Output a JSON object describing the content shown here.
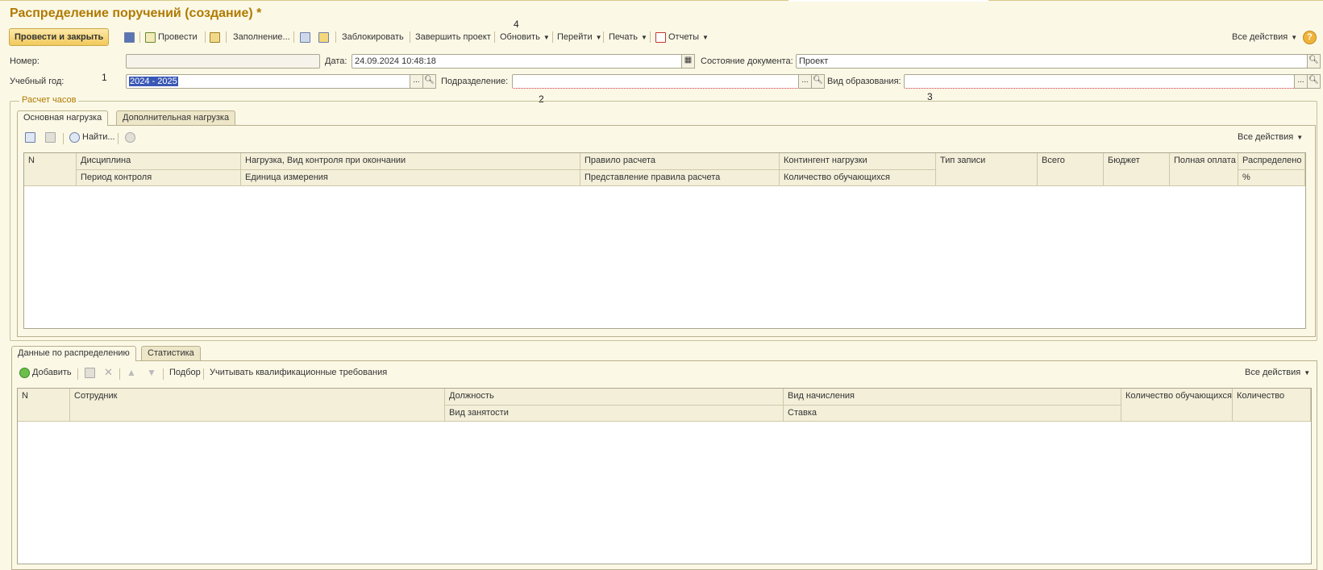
{
  "window": {
    "title": "Распределение поручений (создание) *"
  },
  "toolbar": {
    "post_close": "Провести и закрыть",
    "post": "Провести",
    "fill": "Заполнение...",
    "lock": "Заблокировать",
    "finish": "Завершить проект",
    "refresh": "Обновить",
    "goto": "Перейти",
    "print": "Печать",
    "reports": "Отчеты",
    "all_actions": "Все действия",
    "help": "?"
  },
  "annotations": {
    "n1": "1",
    "n2": "2",
    "n3": "3",
    "n4": "4"
  },
  "fields": {
    "number_label": "Номер:",
    "number_value": "",
    "date_label": "Дата:",
    "date_value": "24.09.2024 10:48:18",
    "state_label": "Состояние документа:",
    "state_value": "Проект",
    "year_label": "Учебный год:",
    "year_value": "2024 - 2025",
    "division_label": "Подразделение:",
    "division_value": "",
    "edu_label": "Вид образования:",
    "edu_value": ""
  },
  "hours_group": {
    "title": "Расчет часов",
    "tabs": [
      "Основная нагрузка",
      "Дополнительная нагрузка"
    ],
    "find": "Найти...",
    "all_actions": "Все действия",
    "columns": {
      "n": "N",
      "discipline": "Дисциплина",
      "period": "Период контроля",
      "load": "Нагрузка, Вид контроля при окончании",
      "unit": "Единица измерения",
      "rule": "Правило расчета",
      "rule_repr": "Представление правила расчета",
      "contingent": "Контингент нагрузки",
      "students": "Количество обучающихся",
      "record_type": "Тип записи",
      "total": "Всего",
      "budget": "Бюджет",
      "full_pay": "Полная оплата",
      "distributed": "Распределено",
      "percent": "%"
    }
  },
  "distribution": {
    "tabs": [
      "Данные по распределению",
      "Статистика"
    ],
    "add": "Добавить",
    "pick": "Подбор",
    "qualif": "Учитывать квалификационные требования",
    "all_actions": "Все действия",
    "columns": {
      "n": "N",
      "employee": "Сотрудник",
      "position": "Должность",
      "employment": "Вид занятости",
      "accrual": "Вид начисления",
      "rate": "Ставка",
      "students": "Количество обучающихся",
      "quantity": "Количество"
    }
  }
}
